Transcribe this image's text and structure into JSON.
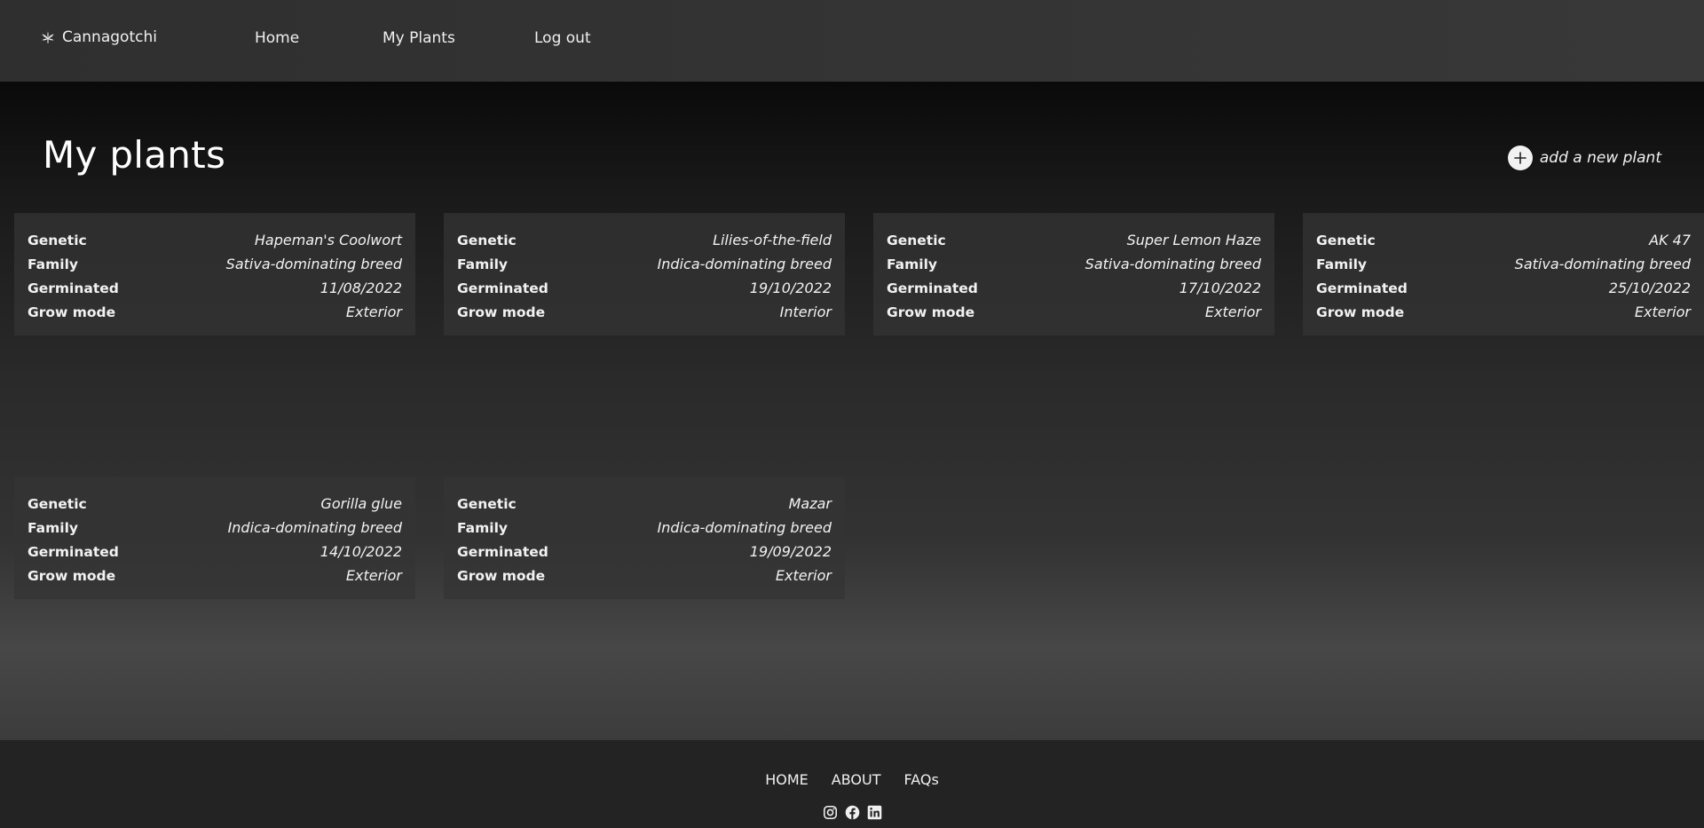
{
  "navbar": {
    "brand": "Cannagotchi",
    "links": {
      "home": "Home",
      "my_plants": "My Plants",
      "log_out": "Log out"
    }
  },
  "main": {
    "title": "My plants",
    "add_plant_label": "add a new plant"
  },
  "cards": [
    {
      "labels": {
        "genetic": "Genetic",
        "family": "Family",
        "germinated": "Germinated",
        "grow_mode": "Grow mode"
      },
      "genetic": "Hapeman's Coolwort",
      "family": "Sativa-dominating breed",
      "germinated": "11/08/2022",
      "grow_mode": "Exterior"
    },
    {
      "labels": {
        "genetic": "Genetic",
        "family": "Family",
        "germinated": "Germinated",
        "grow_mode": "Grow mode"
      },
      "genetic": "Lilies-of-the-field",
      "family": "Indica-dominating breed",
      "germinated": "19/10/2022",
      "grow_mode": "Interior"
    },
    {
      "labels": {
        "genetic": "Genetic",
        "family": "Family",
        "germinated": "Germinated",
        "grow_mode": "Grow mode"
      },
      "genetic": "Super Lemon Haze",
      "family": "Sativa-dominating breed",
      "germinated": "17/10/2022",
      "grow_mode": "Exterior"
    },
    {
      "labels": {
        "genetic": "Genetic",
        "family": "Family",
        "germinated": "Germinated",
        "grow_mode": "Grow mode"
      },
      "genetic": "AK 47",
      "family": "Sativa-dominating breed",
      "germinated": "25/10/2022",
      "grow_mode": "Exterior"
    },
    {
      "labels": {
        "genetic": "Genetic",
        "family": "Family",
        "germinated": "Germinated",
        "grow_mode": "Grow mode"
      },
      "genetic": "Gorilla glue",
      "family": "Indica-dominating breed",
      "germinated": "14/10/2022",
      "grow_mode": "Exterior"
    },
    {
      "labels": {
        "genetic": "Genetic",
        "family": "Family",
        "germinated": "Germinated",
        "grow_mode": "Grow mode"
      },
      "genetic": "Mazar",
      "family": "Indica-dominating breed",
      "germinated": "19/09/2022",
      "grow_mode": "Exterior"
    }
  ],
  "footer": {
    "links": {
      "home": "HOME",
      "about": "ABOUT",
      "faqs": "FAQs"
    },
    "socials": [
      "instagram-icon",
      "facebook-icon",
      "linkedin-icon"
    ]
  },
  "colors": {
    "navbar_bg": "#333333",
    "page_bg_top": "#0a0a0a",
    "card_bg": "#2e2e2e",
    "footer_bg": "#232323",
    "text": "#f2f2f2"
  }
}
